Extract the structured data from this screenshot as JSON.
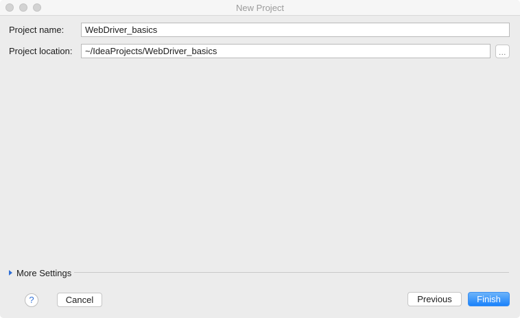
{
  "window": {
    "title": "New Project"
  },
  "form": {
    "project_name_label": "Project name:",
    "project_name_value": "WebDriver_basics",
    "project_location_label": "Project location:",
    "project_location_value": "~/IdeaProjects/WebDriver_basics",
    "browse_label": "..."
  },
  "more_settings": {
    "label": "More Settings",
    "icon": "disclosure-triangle-right"
  },
  "footer": {
    "help_label": "?",
    "cancel_label": "Cancel",
    "previous_label": "Previous",
    "finish_label": "Finish"
  },
  "colors": {
    "accent": "#1a82fb",
    "window_background": "#ececec"
  }
}
